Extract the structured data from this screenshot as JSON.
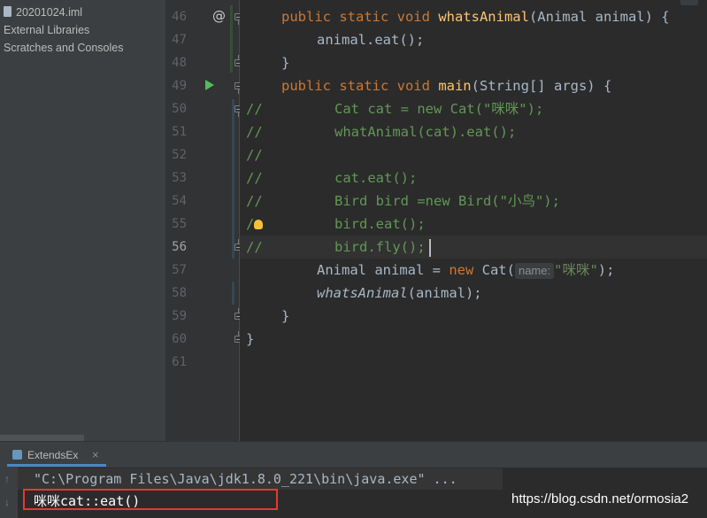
{
  "sidebar": {
    "items": [
      {
        "label": "20201024.iml",
        "icon": "file-icon"
      },
      {
        "label": "External Libraries",
        "icon": "library-icon"
      },
      {
        "label": "Scratches and Consoles",
        "icon": "scratches-icon"
      }
    ]
  },
  "gutter": {
    "line_numbers": [
      "46",
      "47",
      "48",
      "49",
      "50",
      "51",
      "52",
      "53",
      "54",
      "55",
      "56",
      "57",
      "58",
      "59",
      "60",
      "61"
    ],
    "current_line": "56",
    "override_marker": "@"
  },
  "code": {
    "l46": {
      "kw": "public static void ",
      "fn": "whatsAnimal",
      "rest": "(Animal animal) {"
    },
    "l47": "animal.eat();",
    "l48": "}",
    "l49": {
      "kw": "public static void ",
      "fn": "main",
      "rest": "(String[] args) {"
    },
    "l50": {
      "prefix": "//",
      "body": "Cat cat = new Cat(\"咪咪\");"
    },
    "l51": {
      "prefix": "//",
      "body": "whatAnimal(cat).eat();"
    },
    "l52": {
      "prefix": "//",
      "body": ""
    },
    "l53": {
      "prefix": "//",
      "body": "cat.eat();"
    },
    "l54": {
      "prefix": "//",
      "body": "Bird bird =new Bird(\"小鸟\");"
    },
    "l55": {
      "prefix": "/",
      "body": "bird.eat();"
    },
    "l56": {
      "prefix": "//",
      "body": "bird.fly();"
    },
    "l57": {
      "start": "Animal animal = ",
      "kw": "new ",
      "cls": "Cat(",
      "hint": "name:",
      "str": "\"咪咪\"",
      "end": ");"
    },
    "l58": {
      "fn": "whatsAnimal",
      "rest": "(animal);"
    },
    "l59": "}",
    "l60": "}"
  },
  "run_panel": {
    "tab_label": "ExtendsEx",
    "close_glyph": "×",
    "command": "\"C:\\Program Files\\Java\\jdk1.8.0_221\\bin\\java.exe\" ...",
    "output": "咪咪cat::eat()"
  },
  "watermark": "https://blog.csdn.net/ormosia2",
  "colors": {
    "keyword": "#cc7832",
    "method": "#ffc66d",
    "comment": "#629755",
    "string": "#6a8759",
    "highlight_box": "#e53935",
    "run_icon": "#4fbe5c"
  }
}
